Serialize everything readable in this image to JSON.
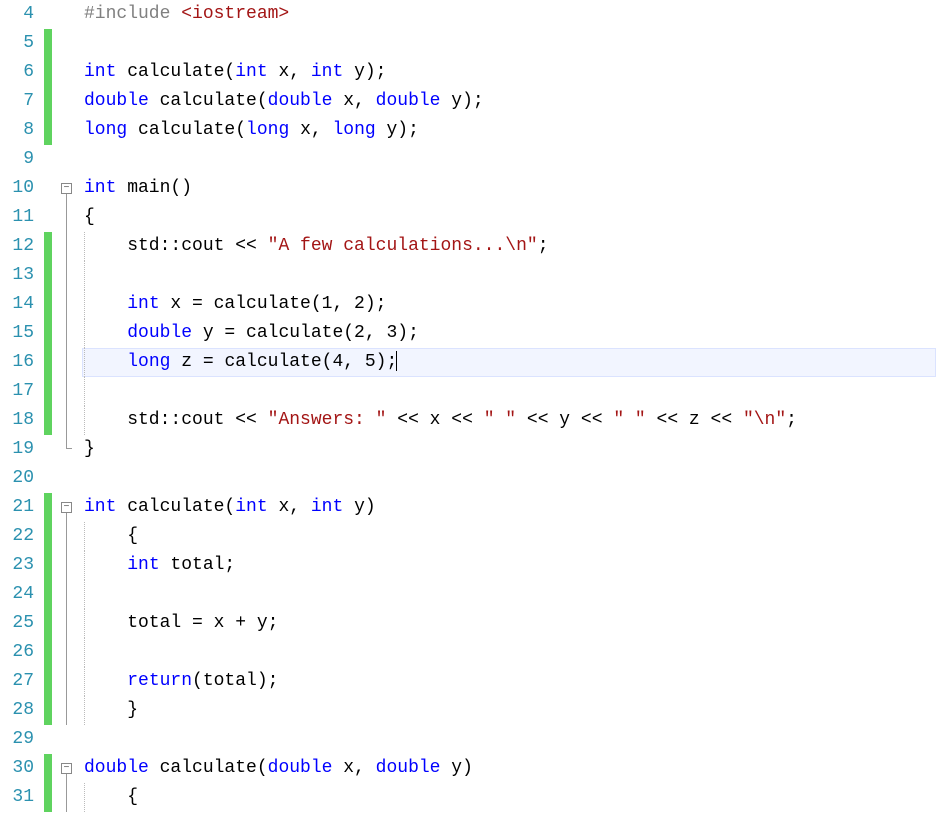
{
  "current_line_num": 16,
  "lines": [
    {
      "num": 4,
      "changed": false,
      "outline": "",
      "guide": 0,
      "tokens": [
        {
          "cls": "pre",
          "t": "#include "
        },
        {
          "cls": "inc",
          "t": "<iostream>"
        }
      ]
    },
    {
      "num": 5,
      "changed": true,
      "outline": "",
      "guide": 0,
      "tokens": []
    },
    {
      "num": 6,
      "changed": true,
      "outline": "",
      "guide": 0,
      "tokens": [
        {
          "cls": "typ",
          "t": "int"
        },
        {
          "cls": "id",
          "t": " calculate("
        },
        {
          "cls": "typ",
          "t": "int"
        },
        {
          "cls": "id",
          "t": " x, "
        },
        {
          "cls": "typ",
          "t": "int"
        },
        {
          "cls": "id",
          "t": " y);"
        }
      ]
    },
    {
      "num": 7,
      "changed": true,
      "outline": "",
      "guide": 0,
      "tokens": [
        {
          "cls": "typ",
          "t": "double"
        },
        {
          "cls": "id",
          "t": " calculate("
        },
        {
          "cls": "typ",
          "t": "double"
        },
        {
          "cls": "id",
          "t": " x, "
        },
        {
          "cls": "typ",
          "t": "double"
        },
        {
          "cls": "id",
          "t": " y);"
        }
      ]
    },
    {
      "num": 8,
      "changed": true,
      "outline": "",
      "guide": 0,
      "tokens": [
        {
          "cls": "typ",
          "t": "long"
        },
        {
          "cls": "id",
          "t": " calculate("
        },
        {
          "cls": "typ",
          "t": "long"
        },
        {
          "cls": "id",
          "t": " x, "
        },
        {
          "cls": "typ",
          "t": "long"
        },
        {
          "cls": "id",
          "t": " y);"
        }
      ]
    },
    {
      "num": 9,
      "changed": false,
      "outline": "",
      "guide": 0,
      "tokens": []
    },
    {
      "num": 10,
      "changed": false,
      "outline": "box",
      "guide": 0,
      "tokens": [
        {
          "cls": "typ",
          "t": "int"
        },
        {
          "cls": "id",
          "t": " main()"
        }
      ]
    },
    {
      "num": 11,
      "changed": false,
      "outline": "line",
      "guide": 0,
      "tokens": [
        {
          "cls": "brace",
          "t": "{"
        }
      ]
    },
    {
      "num": 12,
      "changed": true,
      "outline": "line",
      "guide": 1,
      "tokens": [
        {
          "cls": "id",
          "t": "    std::cout << "
        },
        {
          "cls": "str",
          "t": "\"A few calculations...\\n\""
        },
        {
          "cls": "id",
          "t": ";"
        }
      ]
    },
    {
      "num": 13,
      "changed": true,
      "outline": "line",
      "guide": 1,
      "tokens": []
    },
    {
      "num": 14,
      "changed": true,
      "outline": "line",
      "guide": 1,
      "tokens": [
        {
          "cls": "id",
          "t": "    "
        },
        {
          "cls": "typ",
          "t": "int"
        },
        {
          "cls": "id",
          "t": " x = calculate(1, 2);"
        }
      ]
    },
    {
      "num": 15,
      "changed": true,
      "outline": "line",
      "guide": 1,
      "tokens": [
        {
          "cls": "id",
          "t": "    "
        },
        {
          "cls": "typ",
          "t": "double"
        },
        {
          "cls": "id",
          "t": " y = calculate(2, 3);"
        }
      ]
    },
    {
      "num": 16,
      "changed": true,
      "outline": "line",
      "guide": 1,
      "current": true,
      "caret": true,
      "tokens": [
        {
          "cls": "id",
          "t": "    "
        },
        {
          "cls": "typ",
          "t": "long"
        },
        {
          "cls": "id",
          "t": " z = calculate(4, 5);"
        }
      ]
    },
    {
      "num": 17,
      "changed": true,
      "outline": "line",
      "guide": 1,
      "tokens": []
    },
    {
      "num": 18,
      "changed": true,
      "outline": "line",
      "guide": 1,
      "tokens": [
        {
          "cls": "id",
          "t": "    std::cout << "
        },
        {
          "cls": "str",
          "t": "\"Answers: \""
        },
        {
          "cls": "id",
          "t": " << x << "
        },
        {
          "cls": "str",
          "t": "\" \""
        },
        {
          "cls": "id",
          "t": " << y << "
        },
        {
          "cls": "str",
          "t": "\" \""
        },
        {
          "cls": "id",
          "t": " << z << "
        },
        {
          "cls": "str",
          "t": "\"\\n\""
        },
        {
          "cls": "id",
          "t": ";"
        }
      ]
    },
    {
      "num": 19,
      "changed": false,
      "outline": "end",
      "guide": 0,
      "tokens": [
        {
          "cls": "brace",
          "t": "}"
        }
      ]
    },
    {
      "num": 20,
      "changed": false,
      "outline": "",
      "guide": 0,
      "tokens": []
    },
    {
      "num": 21,
      "changed": true,
      "outline": "box",
      "guide": 0,
      "tokens": [
        {
          "cls": "typ",
          "t": "int"
        },
        {
          "cls": "id",
          "t": " calculate("
        },
        {
          "cls": "typ",
          "t": "int"
        },
        {
          "cls": "id",
          "t": " x, "
        },
        {
          "cls": "typ",
          "t": "int"
        },
        {
          "cls": "id",
          "t": " y)"
        }
      ]
    },
    {
      "num": 22,
      "changed": true,
      "outline": "line",
      "guide": 1,
      "tokens": [
        {
          "cls": "id",
          "t": "    "
        },
        {
          "cls": "brace",
          "t": "{"
        }
      ]
    },
    {
      "num": 23,
      "changed": true,
      "outline": "line",
      "guide": 1,
      "tokens": [
        {
          "cls": "id",
          "t": "    "
        },
        {
          "cls": "typ",
          "t": "int"
        },
        {
          "cls": "id",
          "t": " total;"
        }
      ]
    },
    {
      "num": 24,
      "changed": true,
      "outline": "line",
      "guide": 1,
      "tokens": []
    },
    {
      "num": 25,
      "changed": true,
      "outline": "line",
      "guide": 1,
      "tokens": [
        {
          "cls": "id",
          "t": "    total = x + y;"
        }
      ]
    },
    {
      "num": 26,
      "changed": true,
      "outline": "line",
      "guide": 1,
      "tokens": []
    },
    {
      "num": 27,
      "changed": true,
      "outline": "line",
      "guide": 1,
      "tokens": [
        {
          "cls": "id",
          "t": "    "
        },
        {
          "cls": "kw",
          "t": "return"
        },
        {
          "cls": "id",
          "t": "(total);"
        }
      ]
    },
    {
      "num": 28,
      "changed": true,
      "outline": "line",
      "guide": 1,
      "tokens": [
        {
          "cls": "id",
          "t": "    "
        },
        {
          "cls": "brace",
          "t": "}"
        }
      ]
    },
    {
      "num": 29,
      "changed": false,
      "outline": "",
      "guide": 0,
      "tokens": []
    },
    {
      "num": 30,
      "changed": true,
      "outline": "box",
      "guide": 0,
      "tokens": [
        {
          "cls": "typ",
          "t": "double"
        },
        {
          "cls": "id",
          "t": " calculate("
        },
        {
          "cls": "typ",
          "t": "double"
        },
        {
          "cls": "id",
          "t": " x, "
        },
        {
          "cls": "typ",
          "t": "double"
        },
        {
          "cls": "id",
          "t": " y)"
        }
      ]
    },
    {
      "num": 31,
      "changed": true,
      "outline": "line",
      "guide": 1,
      "tokens": [
        {
          "cls": "id",
          "t": "    "
        },
        {
          "cls": "brace",
          "t": "{"
        }
      ]
    }
  ]
}
